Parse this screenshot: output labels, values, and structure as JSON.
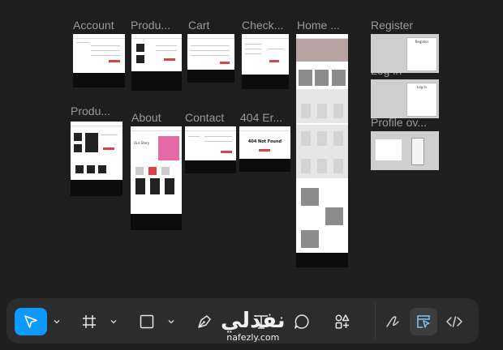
{
  "frames": {
    "account": "Account",
    "products": "Produ...",
    "cart": "Cart",
    "checkout": "Check...",
    "home": "Home ...",
    "register": "Register",
    "login": "Log in",
    "product_detail": "Produ...",
    "about": "About",
    "contact": "Contact",
    "not_found": "404 Er...",
    "profile": "Profile ov..."
  },
  "mockups": {
    "not_found_title": "404 Not Found",
    "about_heading": "Our Story",
    "register_heading": "Register",
    "login_heading": "Log In"
  },
  "toolbar": {
    "tools": [
      "Move",
      "Frame",
      "Shape",
      "Pen",
      "Text",
      "Comment",
      "Actions"
    ],
    "modes": [
      "Draw",
      "Design",
      "Dev Mode"
    ]
  },
  "watermark": {
    "arabic": "نفذلي",
    "latin": "nafezly.com"
  },
  "colors": {
    "canvas": "#1e1e1e",
    "toolbar": "#2c2c2c",
    "accent": "#0d99ff",
    "mock_red": "#db4444"
  }
}
